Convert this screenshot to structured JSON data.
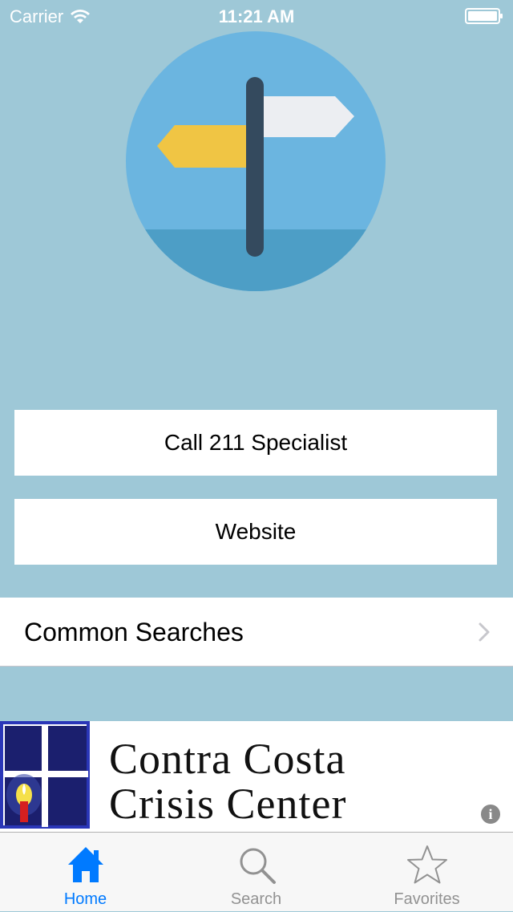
{
  "status_bar": {
    "carrier": "Carrier",
    "time": "11:21 AM",
    "wifi_icon": "wifi-icon",
    "battery_icon": "battery-icon"
  },
  "hero": {
    "icon": "signpost-icon",
    "colors": {
      "circle": "#6bb5e0",
      "circle_bottom": "#4d9ec6",
      "post": "#344a5e",
      "left_sign": "#f0c544",
      "right_sign": "#eceef2"
    }
  },
  "buttons": {
    "call_label": "Call 211 Specialist",
    "website_label": "Website"
  },
  "common_searches": {
    "label": "Common Searches",
    "icon": "chevron-right-icon"
  },
  "banner": {
    "line1": "Contra Costa",
    "line2": "Crisis Center",
    "info_label": "i",
    "logo_icon": "candle-window-logo"
  },
  "tab_bar": {
    "tabs": [
      {
        "label": "Home",
        "icon": "home-icon",
        "selected": true
      },
      {
        "label": "Search",
        "icon": "search-icon",
        "selected": false
      },
      {
        "label": "Favorites",
        "icon": "star-icon",
        "selected": false
      }
    ],
    "active_color": "#007aff",
    "inactive_color": "#929292"
  },
  "colors": {
    "background": "#9ec8d7",
    "button_background": "#ffffff"
  }
}
